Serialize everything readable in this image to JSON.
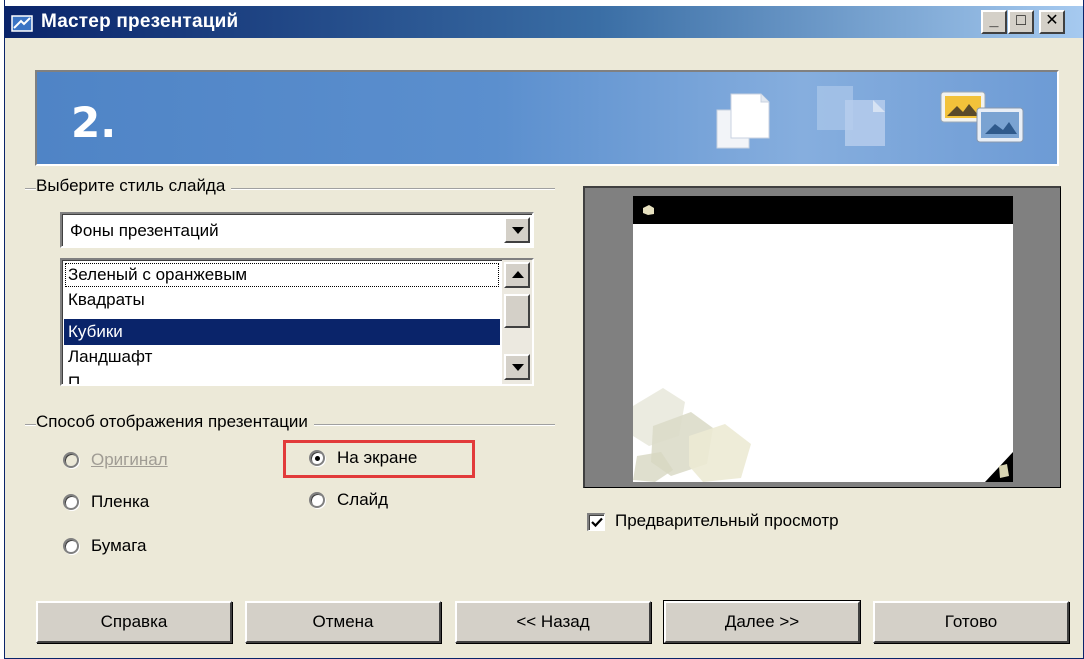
{
  "window": {
    "title": "Мастер презентаций",
    "minimize": "_",
    "maximize": "□",
    "close": "✕"
  },
  "banner": {
    "step": "2.",
    "icons": [
      "pages-icon",
      "pages-faded-icon",
      "picture-icon"
    ]
  },
  "slide_style": {
    "group_label": "Выберите стиль слайда",
    "combo_value": "Фоны презентаций",
    "items": [
      "Зеленый с оранжевым",
      "Квадраты",
      "Кубики",
      "Ландшафт",
      "П"
    ],
    "selected": "Кубики"
  },
  "display_mode": {
    "group_label": "Способ отображения презентации",
    "options": [
      {
        "label": "Оригинал",
        "selected": false,
        "disabled": true
      },
      {
        "label": "На экране",
        "selected": true,
        "disabled": false
      },
      {
        "label": "Пленка",
        "selected": false,
        "disabled": false
      },
      {
        "label": "Слайд",
        "selected": false,
        "disabled": false
      },
      {
        "label": "Бумага",
        "selected": false,
        "disabled": false
      }
    ],
    "highlight_color": "#e23b3b"
  },
  "preview": {
    "checkbox_label": "Предварительный просмотр",
    "checked": true
  },
  "buttons": {
    "help": "Справка",
    "cancel": "Отмена",
    "back": "<< Назад",
    "next": "Далее >>",
    "finish": "Готово"
  },
  "colors": {
    "selection": "#0a246a",
    "dialog_bg": "#ece9d8"
  }
}
